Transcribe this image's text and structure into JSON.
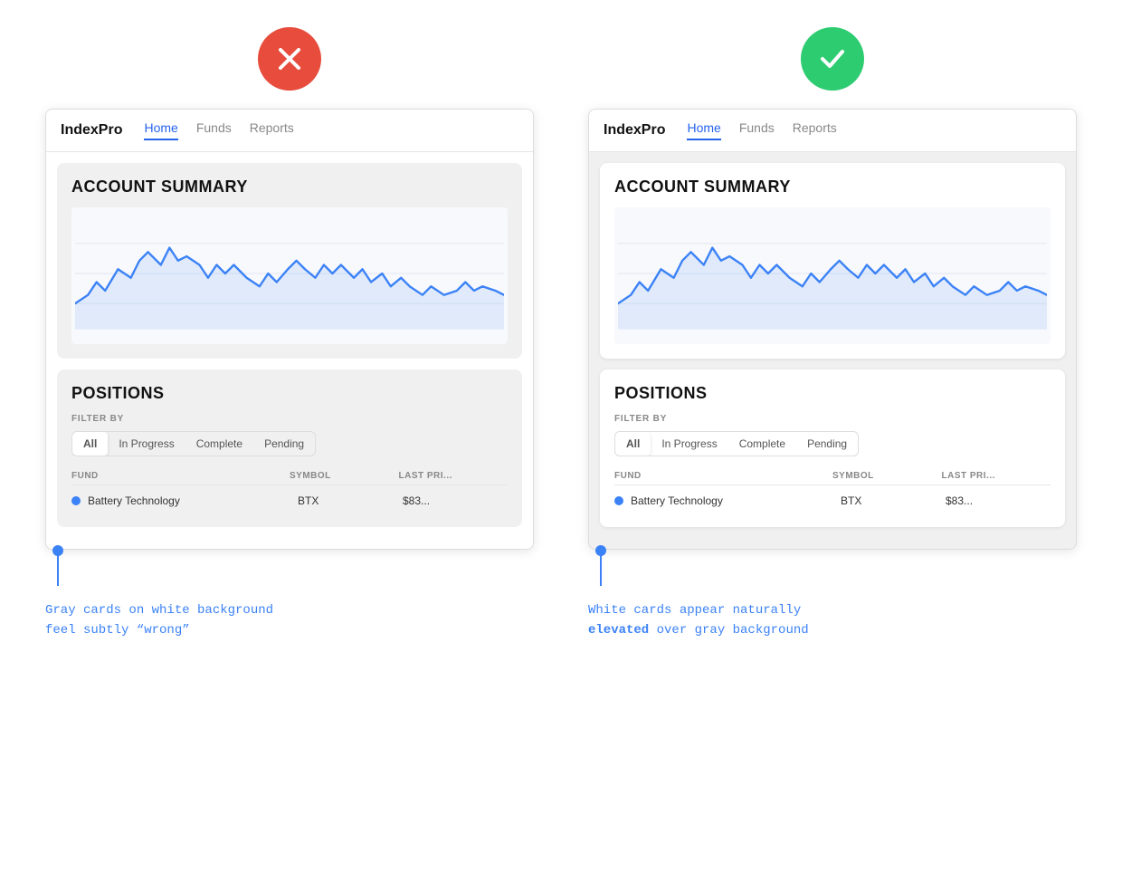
{
  "bad_example": {
    "badge": "bad",
    "icon_type": "x",
    "nav": {
      "logo": "IndexPro",
      "tabs": [
        "Home",
        "Funds",
        "Reports"
      ],
      "active_tab": "Home"
    },
    "account_summary": {
      "title": "ACCOUNT SUMMARY"
    },
    "positions": {
      "title": "POSITIONS",
      "filter_label": "FILTER BY",
      "filter_tabs": [
        "All",
        "In Progress",
        "Complete",
        "Pending"
      ],
      "active_filter": "All",
      "table_headers": [
        "FUND",
        "SYMBOL",
        "LAST PRI..."
      ],
      "rows": [
        {
          "fund": "Battery Technology",
          "symbol": "BTX",
          "price": "$83..."
        }
      ]
    },
    "caption": {
      "line1": "Gray cards on white background",
      "line2": "feel subtly “wrong”"
    }
  },
  "good_example": {
    "badge": "good",
    "icon_type": "check",
    "nav": {
      "logo": "IndexPro",
      "tabs": [
        "Home",
        "Funds",
        "Reports"
      ],
      "active_tab": "Home"
    },
    "account_summary": {
      "title": "ACCOUNT SUMMARY"
    },
    "positions": {
      "title": "POSITIONS",
      "filter_label": "FILTER BY",
      "filter_tabs": [
        "All",
        "In Progress",
        "Complete",
        "Pending"
      ],
      "active_filter": "All",
      "table_headers": [
        "FUND",
        "SYMBOL",
        "LAST PRI..."
      ],
      "rows": [
        {
          "fund": "Battery Technology",
          "symbol": "BTX",
          "price": "$83..."
        }
      ]
    },
    "caption": {
      "line1": "White cards appear naturally",
      "line2_plain": "elevated",
      "line2_rest": " over gray background"
    }
  },
  "colors": {
    "bad_badge": "#e74c3c",
    "good_badge": "#2ecc71",
    "blue_accent": "#2563eb",
    "annotation_color": "#3b82f6"
  }
}
